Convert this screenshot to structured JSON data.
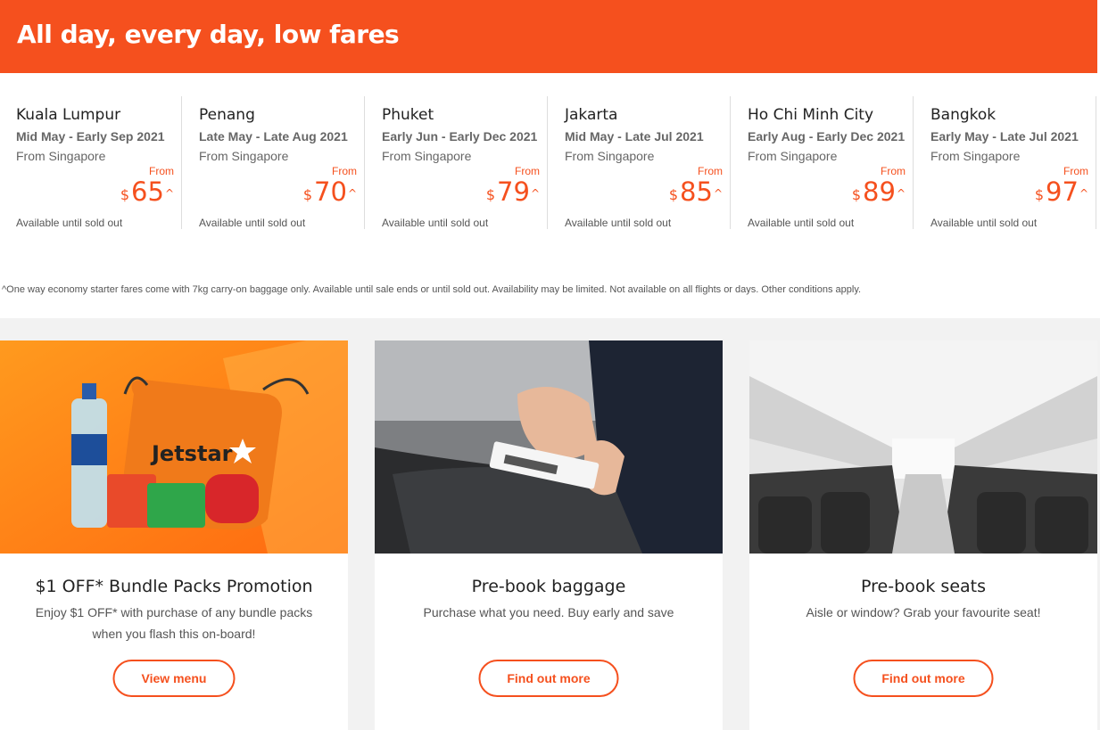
{
  "banner": {
    "title": "All day, every day, low fares"
  },
  "fares": [
    {
      "city": "Kuala Lumpur",
      "dates": "Mid May - Early Sep 2021",
      "origin": "From Singapore",
      "from": "From",
      "currency": "$",
      "price": "65",
      "caret": "^",
      "availability": "Available until sold out"
    },
    {
      "city": "Penang",
      "dates": "Late May - Late Aug 2021",
      "origin": "From Singapore",
      "from": "From",
      "currency": "$",
      "price": "70",
      "caret": "^",
      "availability": "Available until sold out"
    },
    {
      "city": "Phuket",
      "dates": "Early Jun - Early Dec 2021",
      "origin": "From Singapore",
      "from": "From",
      "currency": "$",
      "price": "79",
      "caret": "^",
      "availability": "Available until sold out"
    },
    {
      "city": "Jakarta",
      "dates": "Mid May - Late Jul 2021",
      "origin": "From Singapore",
      "from": "From",
      "currency": "$",
      "price": "85",
      "caret": "^",
      "availability": "Available until sold out"
    },
    {
      "city": "Ho Chi Minh City",
      "dates": "Early Aug - Early Dec 2021",
      "origin": "From Singapore",
      "from": "From",
      "currency": "$",
      "price": "89",
      "caret": "^",
      "availability": "Available until sold out"
    },
    {
      "city": "Bangkok",
      "dates": "Early May - Late Jul 2021",
      "origin": "From Singapore",
      "from": "From",
      "currency": "$",
      "price": "97",
      "caret": "^",
      "availability": "Available until sold out"
    }
  ],
  "disclaimer": "^One way economy starter fares come with 7kg carry-on baggage only. Available until sale ends or until sold out. Availability may be limited. Not available on all flights or days. Other conditions apply.",
  "promos": [
    {
      "title": "$1 OFF* Bundle Packs Promotion",
      "description": "Enjoy $1 OFF* with purchase of any bundle packs when you flash this on-board!",
      "button": "View menu",
      "image_logo": "Jetstar"
    },
    {
      "title": "Pre-book baggage",
      "description": "Purchase what you need. Buy early and save",
      "button": "Find out more"
    },
    {
      "title": "Pre-book seats",
      "description": "Aisle or window? Grab your favourite seat!",
      "button": "Find out more"
    }
  ],
  "colors": {
    "brand": "#f5501e",
    "background": "#f2f2f2"
  }
}
